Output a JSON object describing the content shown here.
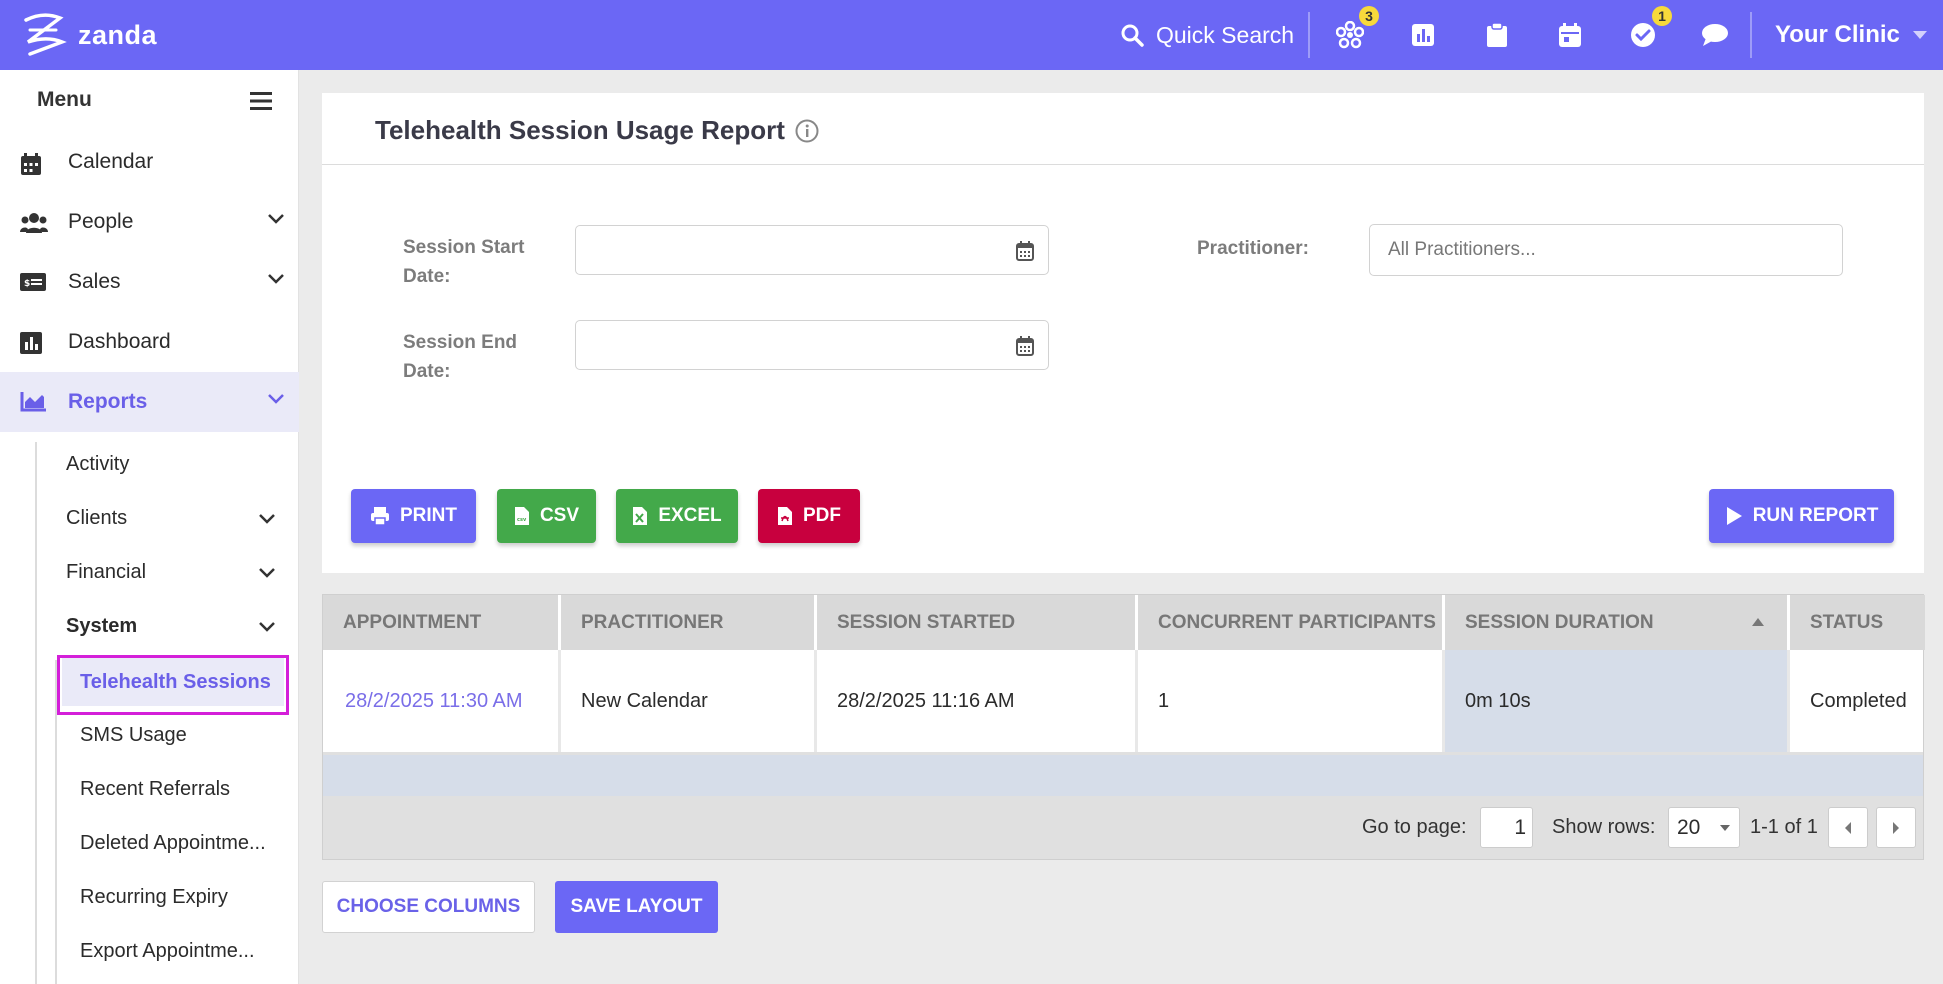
{
  "app": {
    "logo_text": "zanda",
    "brand_color": "#6b67f5"
  },
  "topbar": {
    "search_label": "Quick Search",
    "icons": [
      {
        "name": "apps-icon",
        "badge": "3"
      },
      {
        "name": "reports-icon",
        "badge": ""
      },
      {
        "name": "clipboard-icon",
        "badge": ""
      },
      {
        "name": "calendar-icon",
        "badge": ""
      },
      {
        "name": "tasks-icon",
        "badge": "1"
      },
      {
        "name": "chat-icon",
        "badge": ""
      }
    ],
    "clinic_label": "Your Clinic"
  },
  "sidebar": {
    "menu_label": "Menu",
    "items": [
      {
        "label": "Calendar"
      },
      {
        "label": "People"
      },
      {
        "label": "Sales"
      },
      {
        "label": "Dashboard"
      },
      {
        "label": "Reports"
      }
    ],
    "report_sub": [
      {
        "label": "Activity"
      },
      {
        "label": "Clients"
      },
      {
        "label": "Financial"
      },
      {
        "label": "System"
      }
    ],
    "system_sub": [
      {
        "label": "Telehealth Sessions"
      },
      {
        "label": "SMS Usage"
      },
      {
        "label": "Recent Referrals"
      },
      {
        "label": "Deleted Appointme..."
      },
      {
        "label": "Recurring Expiry"
      },
      {
        "label": "Export Appointme..."
      }
    ]
  },
  "report": {
    "title": "Telehealth Session Usage Report",
    "start_label_1": "Session Start",
    "start_label_2": "Date:",
    "end_label_1": "Session End",
    "end_label_2": "Date:",
    "practitioner_label": "Practitioner:",
    "practitioner_placeholder": "All Practitioners...",
    "buttons": {
      "print": "PRINT",
      "csv": "CSV",
      "excel": "EXCEL",
      "pdf": "PDF",
      "run": "RUN REPORT"
    }
  },
  "table": {
    "headers": [
      "APPOINTMENT",
      "PRACTITIONER",
      "SESSION STARTED",
      "CONCURRENT PARTICIPANTS",
      "SESSION DURATION",
      "STATUS"
    ],
    "rows": [
      [
        "28/2/2025 11:30 AM",
        "New Calendar",
        "28/2/2025 11:16 AM",
        "1",
        "0m 10s",
        "Completed"
      ]
    ],
    "pager": {
      "goto_label": "Go to page:",
      "page": "1",
      "rows_label": "Show rows:",
      "rows": "20",
      "range": "1-1 of 1"
    }
  },
  "footer": {
    "choose_columns": "CHOOSE COLUMNS",
    "save_layout": "SAVE LAYOUT"
  }
}
